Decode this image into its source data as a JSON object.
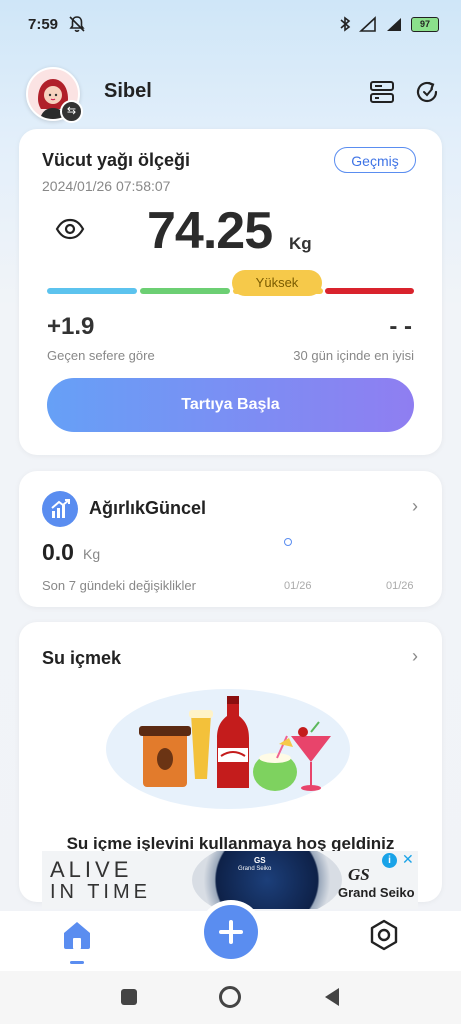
{
  "status_bar": {
    "time": "7:59",
    "battery": "97"
  },
  "header": {
    "username": "Sibel"
  },
  "scale_card": {
    "title": "Vücut yağı ölçeği",
    "datetime": "2024/01/26 07:58:07",
    "history_label": "Geçmiş",
    "weight": "74.25",
    "unit": "Kg",
    "level_label": "Yüksek",
    "change_value": "+1.9",
    "change_label": "Geçen sefere göre",
    "best_value": "- -",
    "best_label": "30 gün içinde en iyisi",
    "start_label": "Tartıya Başla",
    "colors": {
      "blue": "#5cc3ee",
      "green": "#6ccf73",
      "yellow": "#f6c94a",
      "red": "#d9232d",
      "accent": "#3f74e6"
    }
  },
  "weight_card": {
    "title": "AğırlıkGüncel",
    "value": "0.0",
    "unit": "Kg",
    "caption": "Son 7 gündeki değişiklikler",
    "date_start": "01/26",
    "date_end": "01/26"
  },
  "water_card": {
    "title": "Su içmek",
    "welcome": "Su içme işlevini kullanmaya hoş geldiniz"
  },
  "ad": {
    "headline_1": "ALIVE",
    "headline_2": "IN TIME",
    "brand_mark": "GS",
    "brand": "Grand Seiko",
    "watch_mark": "GS",
    "watch_brand": "Grand Seiko"
  },
  "bottom_nav": {
    "items": [
      "home-icon",
      "add-icon",
      "settings-icon"
    ]
  }
}
